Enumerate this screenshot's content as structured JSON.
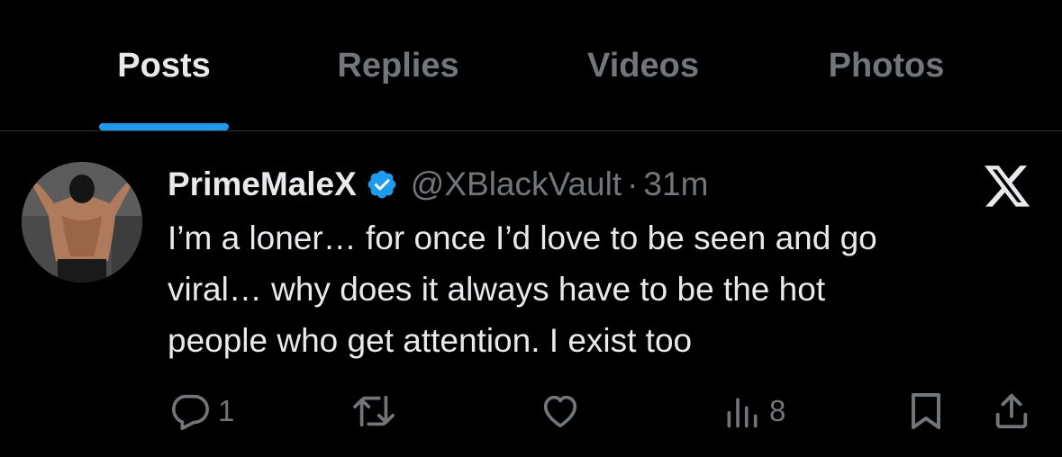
{
  "tabs": [
    {
      "label": "Posts",
      "active": true
    },
    {
      "label": "Replies",
      "active": false
    },
    {
      "label": "Videos",
      "active": false
    },
    {
      "label": "Photos",
      "active": false
    }
  ],
  "post": {
    "display_name": "PrimeMaleX",
    "verified": true,
    "handle": "@XBlackVault",
    "separator": "·",
    "time": "31m",
    "text_lines": [
      "I’m a loner… for once I’d love to be seen and go",
      "viral… why does it always have to be the hot",
      "people who get attention. I exist too"
    ],
    "actions": {
      "reply_count": "1",
      "repost_count": "",
      "like_count": "",
      "views_count": "8"
    }
  },
  "icons": {
    "reply": "reply-icon",
    "repost": "repost-icon",
    "like": "heart-icon",
    "views": "views-icon",
    "bookmark": "bookmark-icon",
    "share": "share-icon",
    "logo": "x-logo-icon",
    "verified": "verified-badge-icon"
  },
  "colors": {
    "background": "#000000",
    "text": "#e7e9ea",
    "muted": "#71767b",
    "accent": "#1d9bf0",
    "divider": "#2f3336"
  }
}
